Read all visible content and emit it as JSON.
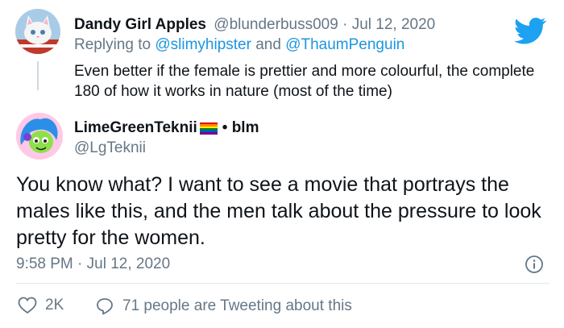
{
  "parent_tweet": {
    "display_name": "Dandy Girl Apples",
    "handle": "@blunderbuss009",
    "date": "Jul 12, 2020",
    "reply_prefix": "Replying to",
    "reply_to_1": "@slimyhipster",
    "reply_and": "and",
    "reply_to_2": "@ThaumPenguin",
    "text": "Even better if the female is prettier and more colourful, the complete 180 of how it works in nature (most of the time)"
  },
  "main_tweet": {
    "display_name": "LimeGreenTeknii",
    "name_suffix": "• blm",
    "handle": "@LgTeknii",
    "text": "You know what? I want to see a movie that portrays the males like this, and the men talk about the pressure to look pretty for the women.",
    "timestamp": "9:58 PM · Jul 12, 2020",
    "likes": "2K",
    "tweeting_about": "71 people are Tweeting about this"
  },
  "icons": {
    "brand": "twitter-bird-icon",
    "info": "info-icon",
    "like": "heart-icon",
    "reply": "comment-bubble-icon",
    "flag": "rainbow-flag-icon"
  },
  "colors": {
    "accent": "#1da1f2",
    "link": "#1b95e0",
    "muted": "#657786",
    "text": "#0f1419"
  }
}
